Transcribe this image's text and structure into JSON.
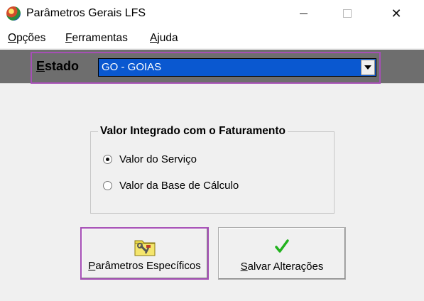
{
  "window": {
    "title": "Parâmetros Gerais LFS",
    "minimize": "",
    "maximize": "",
    "close": "✕"
  },
  "menu": {
    "items": [
      "Opções",
      "Ferramentas",
      "Ajuda"
    ]
  },
  "state": {
    "label": "Estado",
    "selected": "GO - GOIAS"
  },
  "group": {
    "title": "Valor Integrado com o Faturamento",
    "options": [
      {
        "label": "Valor do Serviço",
        "checked": true
      },
      {
        "label": "Valor da Base de Cálculo",
        "checked": false
      }
    ]
  },
  "buttons": {
    "params_label": "Parâmetros Específicos",
    "save_label": "Salvar Alterações",
    "params_icon": "folder-tools-icon",
    "save_icon": "green-checkmark-icon"
  },
  "colors": {
    "highlight": "#a64fb6",
    "select_bg": "#0a58d0",
    "state_bar": "#6e6e6e",
    "check": "#22b21e"
  }
}
